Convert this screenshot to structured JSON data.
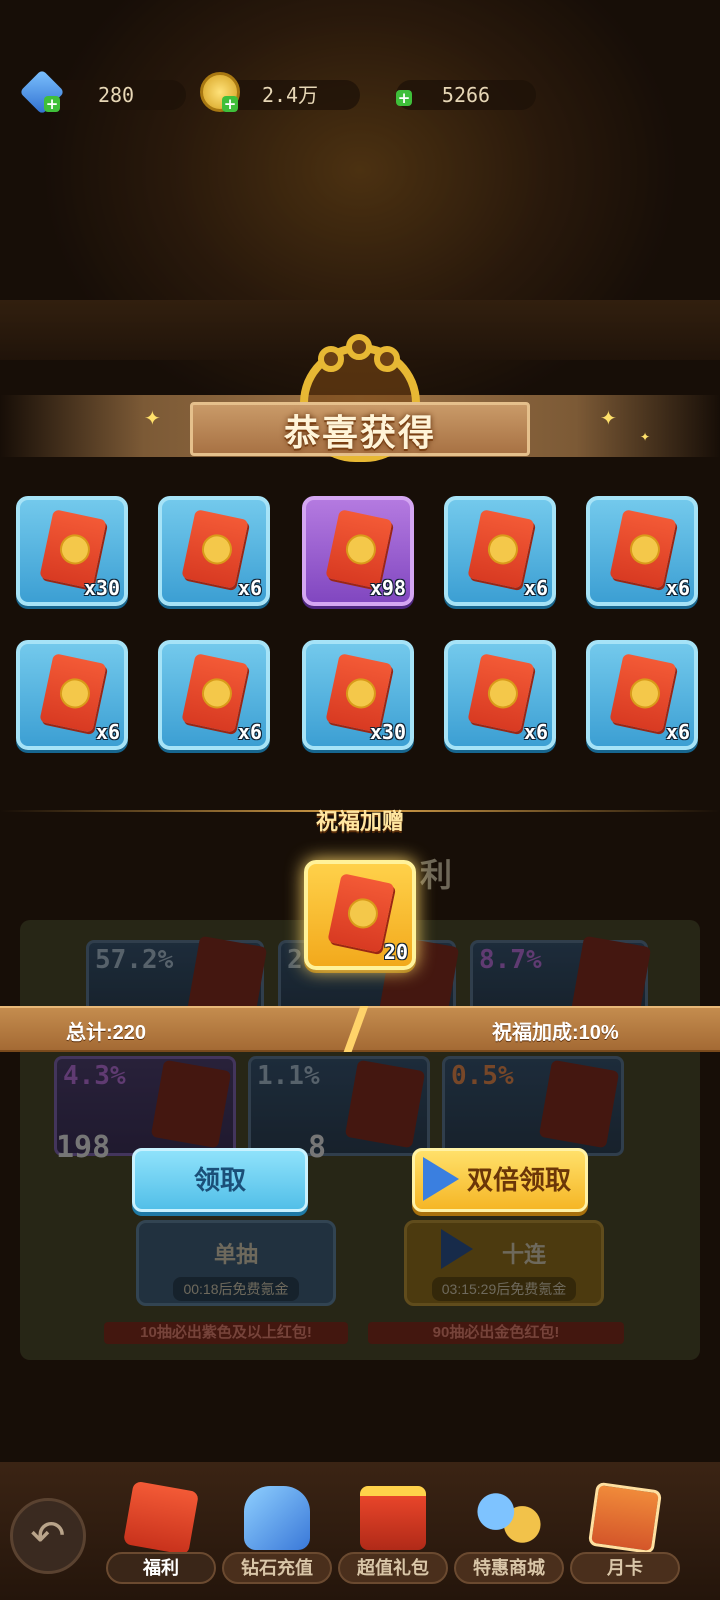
{
  "resources": {
    "gems": "280",
    "coins": "2.4万",
    "energy": "5266"
  },
  "popup": {
    "title": "恭喜获得",
    "rewards": [
      {
        "count": "x30",
        "rarity": "blue"
      },
      {
        "count": "x6",
        "rarity": "blue"
      },
      {
        "count": "x98",
        "rarity": "purple"
      },
      {
        "count": "x6",
        "rarity": "blue"
      },
      {
        "count": "x6",
        "rarity": "blue"
      },
      {
        "count": "x6",
        "rarity": "blue"
      },
      {
        "count": "x6",
        "rarity": "blue"
      },
      {
        "count": "x30",
        "rarity": "blue"
      },
      {
        "count": "x6",
        "rarity": "blue"
      },
      {
        "count": "x6",
        "rarity": "blue"
      }
    ],
    "bonus_label": "祝福加赠",
    "bonus_reward": {
      "count": "20",
      "rarity": "gold"
    },
    "total": "总计:220",
    "blessing_bonus": "祝福加成:10%",
    "claim_button": "领取",
    "double_claim_button": "双倍领取"
  },
  "background": {
    "section_title_partial": "利",
    "odds": [
      {
        "pct": "57.2%",
        "color": "blue"
      },
      {
        "pct": "2",
        "color": "blue"
      },
      {
        "pct": "8.7%",
        "color": "purple"
      },
      {
        "pct": "4.3%",
        "color": "purple"
      },
      {
        "pct": "1.1%",
        "color": "orange"
      },
      {
        "pct": "0.5%",
        "color": "orange"
      }
    ],
    "single_draw": {
      "label": "单抽",
      "timer": "00:18后免费氪金"
    },
    "ten_draw": {
      "label": "十连",
      "timer": "03:15:29后免费氪金"
    },
    "note_left": "10抽必出紫色及以上红包!",
    "note_right": "90抽必出金色红包!",
    "left_count": "198",
    "mid_count": "8"
  },
  "nav": {
    "items": [
      {
        "label": "福利",
        "active": true
      },
      {
        "label": "钻石充值",
        "active": false
      },
      {
        "label": "超值礼包",
        "active": false
      },
      {
        "label": "特惠商城",
        "active": false
      },
      {
        "label": "月卡",
        "active": false
      }
    ]
  },
  "colors": {
    "accent_gold": "#ffd14a",
    "reward_blue": "#52b4e2",
    "reward_purple": "#9a5fd2",
    "envelope_red": "#e8452a"
  }
}
